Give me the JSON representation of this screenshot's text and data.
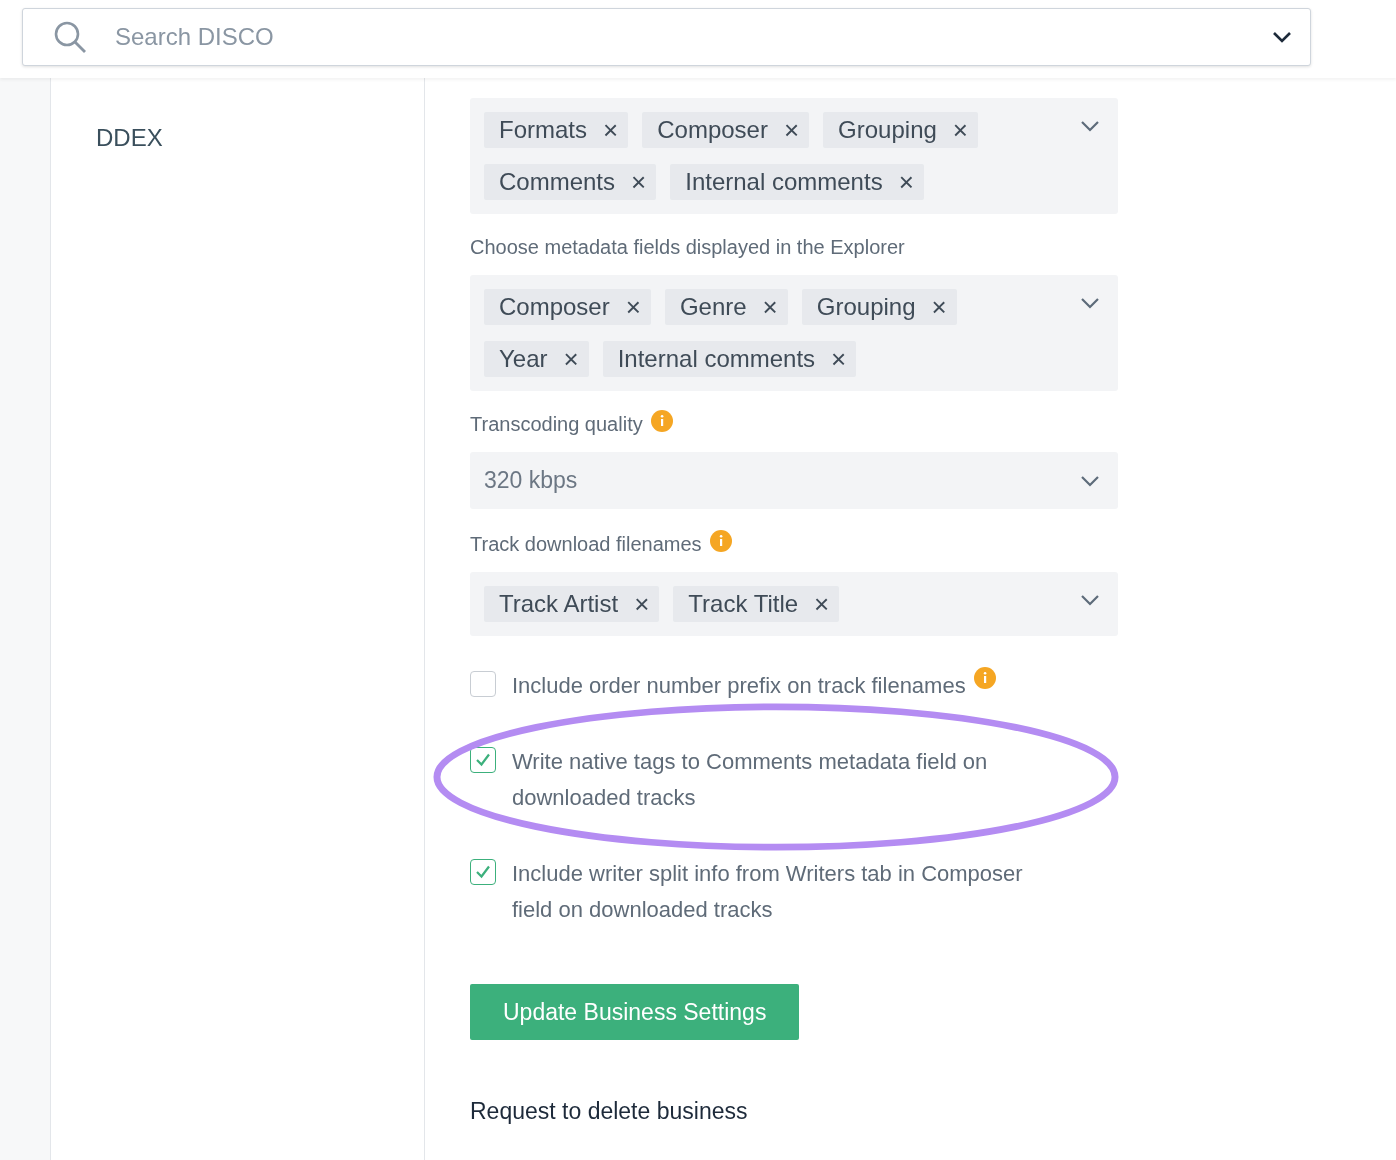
{
  "search": {
    "placeholder": "Search DISCO"
  },
  "sidebar": {
    "items": [
      {
        "label": "DDEX"
      }
    ]
  },
  "sections": [
    {
      "kind": "tags",
      "tags": [
        {
          "label": "Formats",
          "remove": "×"
        },
        {
          "label": "Composer",
          "remove": "×"
        },
        {
          "label": "Grouping",
          "remove": "×"
        },
        {
          "label": "Comments",
          "remove": "×"
        },
        {
          "label": "Internal comments",
          "remove": "×"
        }
      ]
    },
    {
      "kind": "tags",
      "label": "Choose metadata fields displayed in the Explorer",
      "tags": [
        {
          "label": "Composer",
          "remove": "×"
        },
        {
          "label": "Genre",
          "remove": "×"
        },
        {
          "label": "Grouping",
          "remove": "×"
        },
        {
          "label": "Year",
          "remove": "×"
        },
        {
          "label": "Internal comments",
          "remove": "×"
        }
      ]
    },
    {
      "kind": "select",
      "label": "Transcoding quality",
      "info": true,
      "value": "320 kbps"
    },
    {
      "kind": "tags",
      "label": "Track download filenames",
      "info": true,
      "tags": [
        {
          "label": "Track Artist",
          "remove": "×"
        },
        {
          "label": "Track Title",
          "remove": "×"
        }
      ]
    }
  ],
  "checkboxes": [
    {
      "label": "Include order number prefix on track filenames",
      "checked": false,
      "info": true
    },
    {
      "label": "Write native tags to Comments metadata field on downloaded tracks",
      "checked": true,
      "circled": true
    },
    {
      "label": "Include writer split info from Writers tab in Composer field on downloaded tracks",
      "checked": true
    }
  ],
  "button": "Update Business Settings",
  "link": "Request to delete business"
}
